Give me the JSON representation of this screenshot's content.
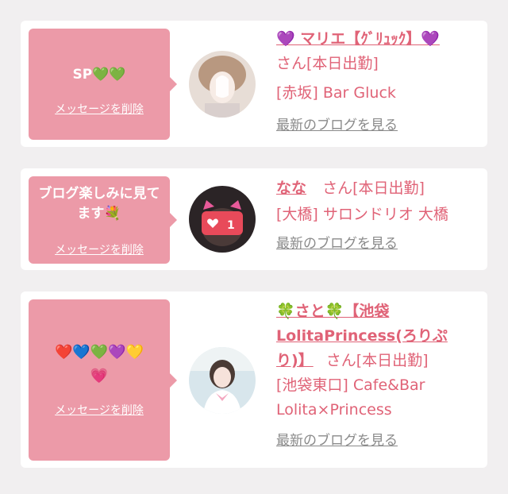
{
  "cards": [
    {
      "message": "SP💚💚",
      "delete_label": "メッセージを削除",
      "name": "💜 マリエ【ｸﾞﾘｭｯｸ】💜",
      "suffix": "さん[本日出勤]",
      "shop": "[赤坂] Bar Gluck",
      "blog_label": "最新のブログを見る"
    },
    {
      "message": "ブログ楽しみに見てます💐",
      "delete_label": "メッセージを削除",
      "name": "なな",
      "suffix": "さん[本日出勤]",
      "shop": "[大橋] サロンドリオ 大橋",
      "like_count": "1",
      "blog_label": "最新のブログを見る"
    },
    {
      "message": "❤️💙💚💜💛💗",
      "delete_label": "メッセージを削除",
      "name": "🍀さと🍀【池袋LolitaPrincess(ろりぷり)】",
      "suffix": "さん[本日出勤]",
      "shop": "[池袋東口] Cafe&Bar Lolita×Princess",
      "blog_label": "最新のブログを見る"
    }
  ],
  "colors": {
    "background": "#f1eff0",
    "bubble": "#ec9aa8",
    "accent_text": "#e06377",
    "link_gray": "#8a8a8a"
  }
}
